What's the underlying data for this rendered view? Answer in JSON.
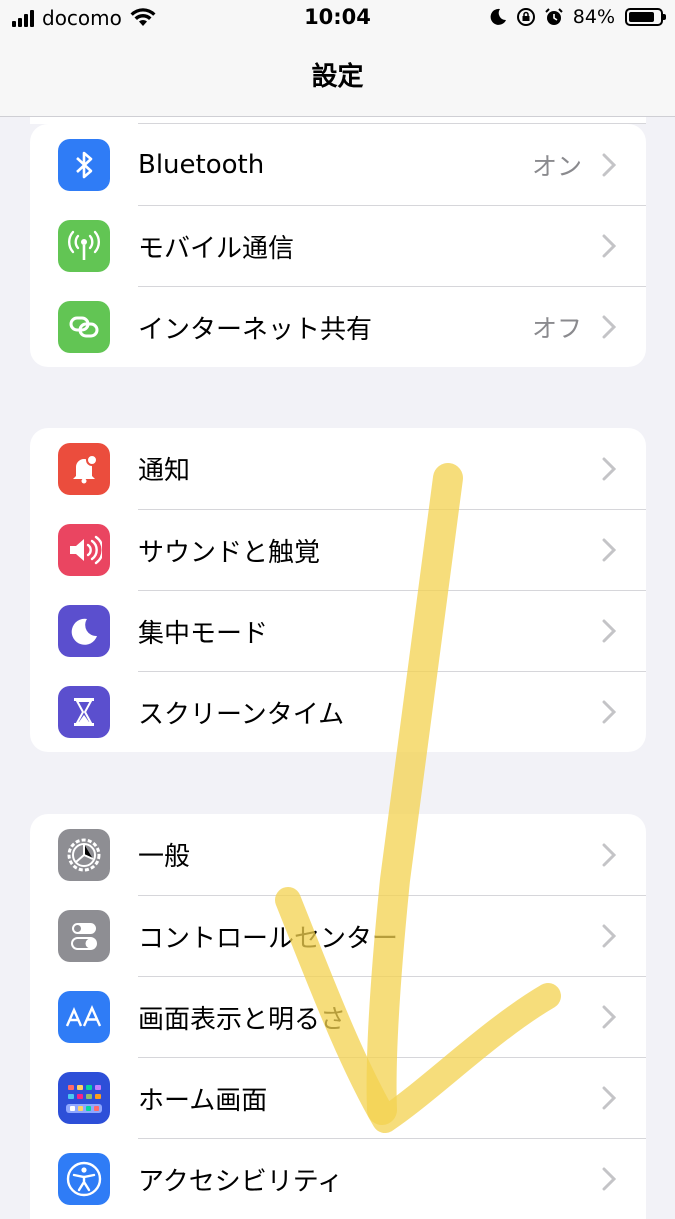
{
  "status": {
    "carrier": "docomo",
    "time": "10:04",
    "battery": "84%",
    "battery_level": 0.84
  },
  "nav": {
    "title": "設定"
  },
  "groups": [
    {
      "rows": [
        {
          "label": "Bluetooth",
          "value": "オン",
          "icon": "bluetooth-icon",
          "color": "#2f7cf6"
        },
        {
          "label": "モバイル通信",
          "value": "",
          "icon": "antenna-icon",
          "color": "#62c554"
        },
        {
          "label": "インターネット共有",
          "value": "オフ",
          "icon": "link-icon",
          "color": "#62c554"
        }
      ]
    },
    {
      "rows": [
        {
          "label": "通知",
          "icon": "bell-icon",
          "color": "#eb4d3d"
        },
        {
          "label": "サウンドと触覚",
          "icon": "speaker-icon",
          "color": "#ea4561"
        },
        {
          "label": "集中モード",
          "icon": "moon-icon",
          "color": "#5b4fce"
        },
        {
          "label": "スクリーンタイム",
          "icon": "hourglass-icon",
          "color": "#5b4fce"
        }
      ]
    },
    {
      "rows": [
        {
          "label": "一般",
          "icon": "gear-icon",
          "color": "#8e8e93"
        },
        {
          "label": "コントロールセンター",
          "icon": "toggles-icon",
          "color": "#8e8e93"
        },
        {
          "label": "画面表示と明るさ",
          "icon": "text-size-icon",
          "color": "#2f7cf6"
        },
        {
          "label": "ホーム画面",
          "icon": "home-grid-icon",
          "color": "#2d4fd8"
        },
        {
          "label": "アクセシビリティ",
          "icon": "accessibility-icon",
          "color": "#2f7cf6"
        }
      ]
    }
  ]
}
